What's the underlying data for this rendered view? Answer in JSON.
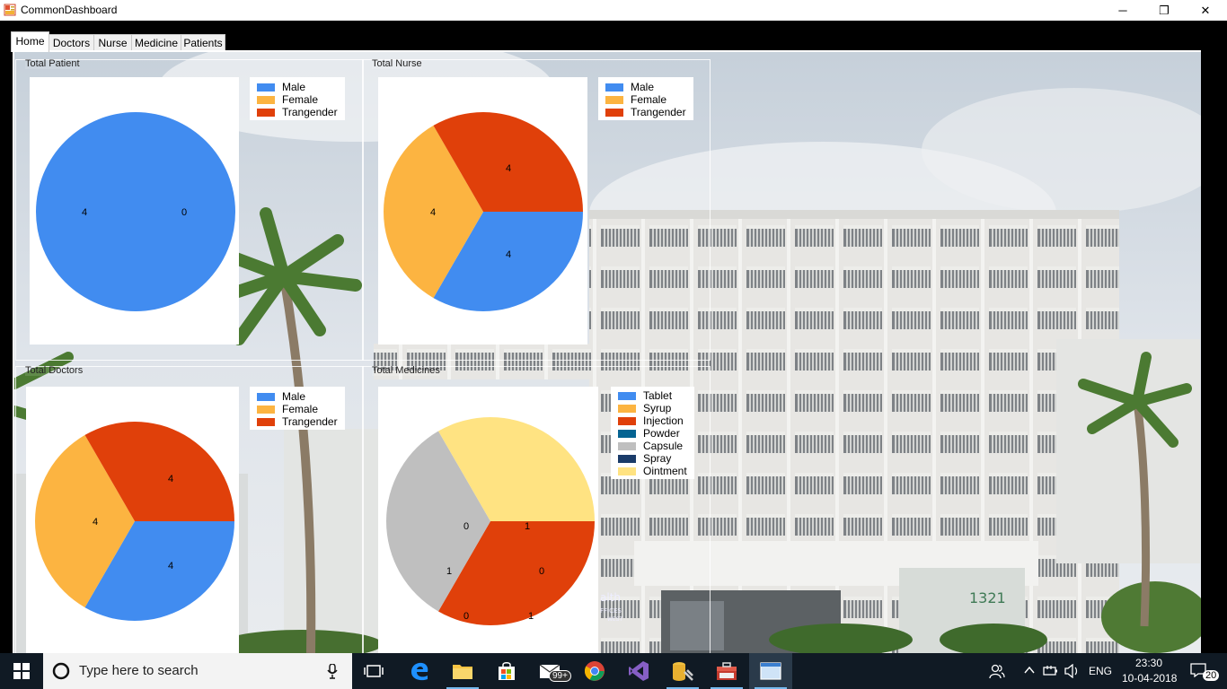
{
  "window": {
    "title": "CommonDashboard",
    "minimize": "─",
    "maximize": "❐",
    "close": "✕"
  },
  "tabs": [
    {
      "label": "Home",
      "active": true
    },
    {
      "label": "Doctors"
    },
    {
      "label": "Nurse"
    },
    {
      "label": "Medicine"
    },
    {
      "label": "Patients"
    }
  ],
  "groups": {
    "patient": {
      "title": "Total Patient"
    },
    "nurse": {
      "title": "Total Nurse"
    },
    "doctors": {
      "title": "Total Doctors"
    },
    "medicines": {
      "title": "Total Medicines"
    }
  },
  "chart_data": [
    {
      "type": "pie",
      "title": "",
      "categories": [
        "Male",
        "Female",
        "Trangender"
      ],
      "values": [
        4,
        0,
        0
      ],
      "colors": [
        "#418cf0",
        "#fcb441",
        "#e0400a"
      ],
      "data_labels": [
        "4",
        "0"
      ]
    },
    {
      "type": "pie",
      "title": "",
      "categories": [
        "Male",
        "Female",
        "Trangender"
      ],
      "values": [
        4,
        4,
        4
      ],
      "colors": [
        "#418cf0",
        "#fcb441",
        "#e0400a"
      ],
      "data_labels": [
        "4",
        "4",
        "4"
      ]
    },
    {
      "type": "pie",
      "title": "",
      "categories": [
        "Male",
        "Female",
        "Trangender"
      ],
      "values": [
        4,
        4,
        4
      ],
      "colors": [
        "#418cf0",
        "#fcb441",
        "#e0400a"
      ],
      "data_labels": [
        "4",
        "4",
        "4"
      ]
    },
    {
      "type": "pie",
      "title": "",
      "categories": [
        "Tablet",
        "Syrup",
        "Injection",
        "Powder",
        "Capsule",
        "Spray",
        "Ointment"
      ],
      "values": [
        0,
        0,
        1,
        0,
        1,
        0,
        1
      ],
      "colors": [
        "#418cf0",
        "#fcb441",
        "#e0400a",
        "#056492",
        "#bfbfbf",
        "#1a3b69",
        "#ffe382"
      ],
      "data_labels": [
        "0",
        "1",
        "0",
        "1",
        "0",
        "1"
      ]
    }
  ],
  "taskbar": {
    "search_placeholder": "Type here to search",
    "mail_badge": "99+",
    "language": "ENG",
    "time": "23:30",
    "date": "10-04-2018",
    "notification_count": "20"
  },
  "background": {
    "building_number": "1321",
    "sign_text": "alth",
    "sign_sub": "FFICES",
    "sign_sub2": "WEST"
  }
}
